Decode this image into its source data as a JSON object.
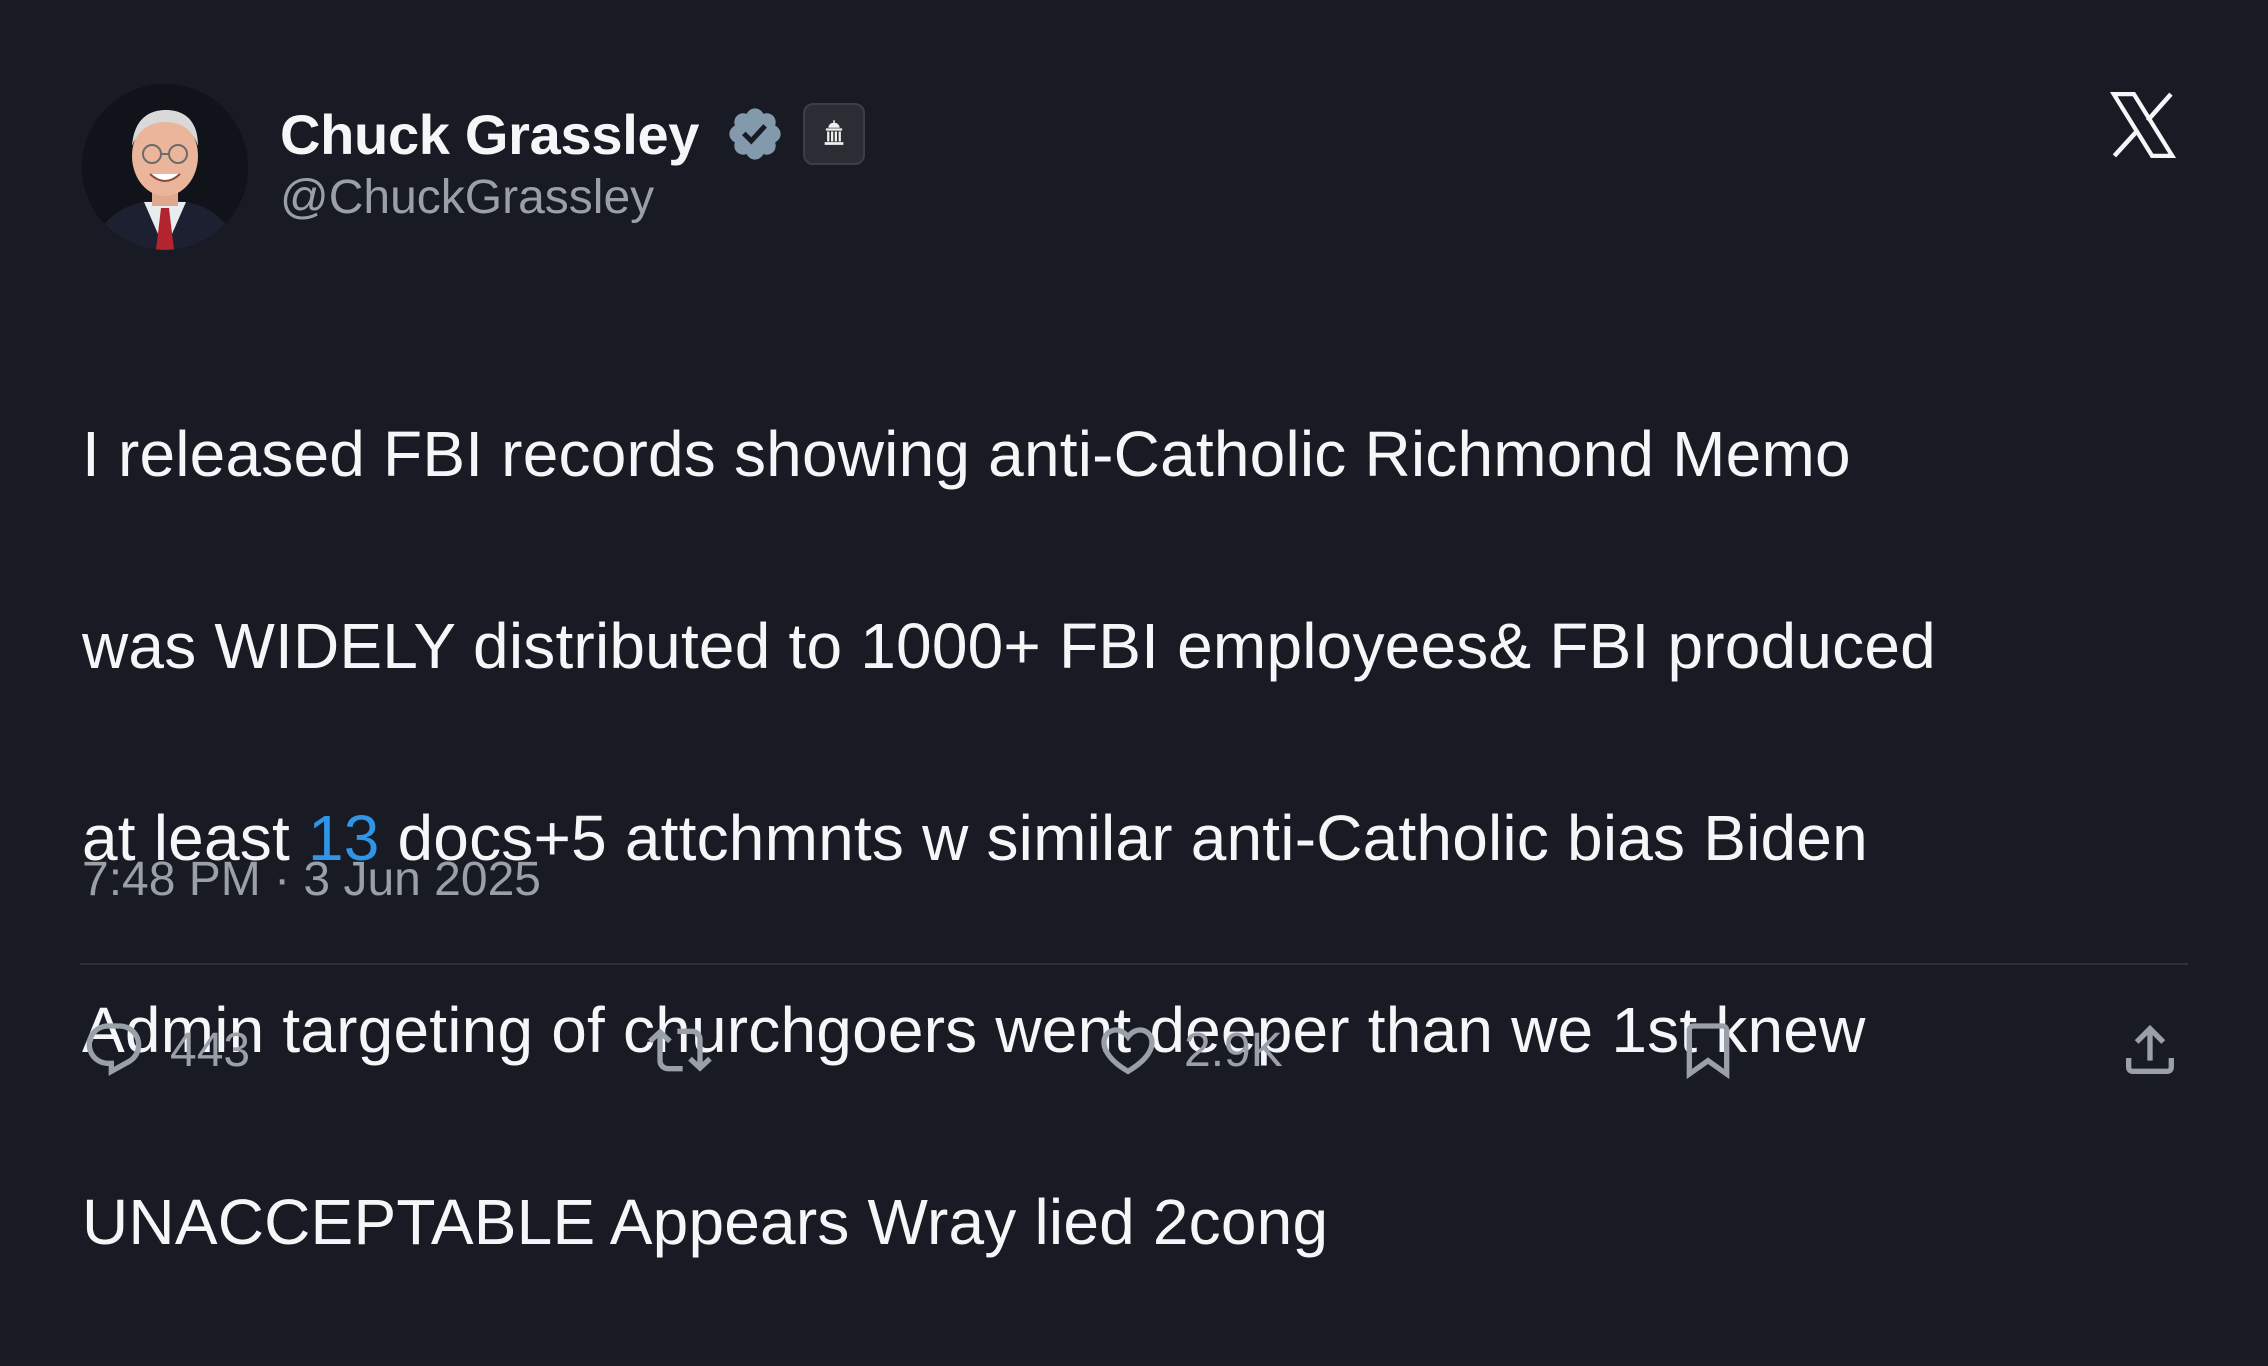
{
  "author": {
    "display_name": "Chuck Grassley",
    "handle": "@ChuckGrassley",
    "avatar_icon": "avatar",
    "verified_icon": "verified-badge-icon",
    "affiliation_icon": "government-building-icon"
  },
  "brand_icon": "x-logo-icon",
  "post": {
    "lines": [
      {
        "before": "I released FBI records showing anti-Catholic Richmond Memo",
        "link": "",
        "after": ""
      },
      {
        "before": "was WIDELY distributed to 1000+ FBI employees& FBI produced",
        "link": "",
        "after": ""
      },
      {
        "before": "at least ",
        "link": "13",
        "after": " docs+5 attchmnts w similar anti-Catholic bias Biden"
      },
      {
        "before": "Admin targeting of churchgoers went deeper than we 1st knew",
        "link": "",
        "after": ""
      },
      {
        "before": "UNACCEPTABLE Appears Wray lied 2cong",
        "link": "",
        "after": ""
      }
    ]
  },
  "meta": {
    "timestamp": "7:48 PM · 3 Jun 2025"
  },
  "actions": {
    "reply_count": "443",
    "repost_count": "",
    "like_count": "2.9K"
  },
  "colors": {
    "background": "#181b23",
    "text_primary": "#f5f6f8",
    "text_secondary": "#9aa0a8",
    "link": "#2f95e6",
    "verified_badge": "#829aab"
  }
}
